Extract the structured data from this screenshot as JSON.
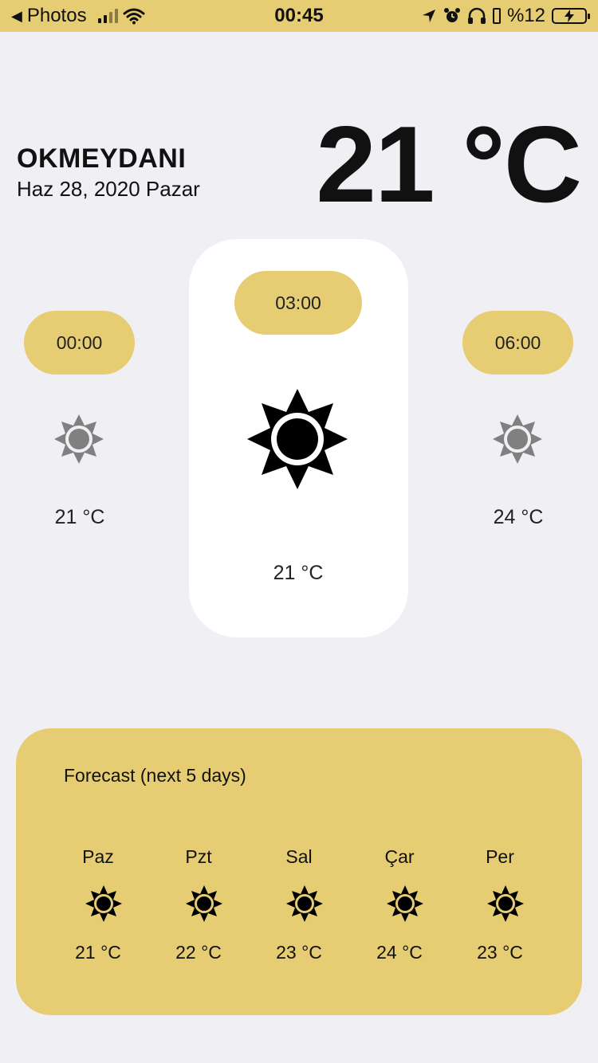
{
  "status_bar": {
    "back_app": "Photos",
    "time": "00:45",
    "battery": "%12",
    "icons": [
      "back-arrow-icon",
      "signal-icon",
      "wifi-icon",
      "location-arrow-icon",
      "alarm-icon",
      "headphones-icon",
      "battery-charging-icon"
    ]
  },
  "header": {
    "location": "OKMEYDANI",
    "date": "Haz 28, 2020 Pazar",
    "temperature": "21 °C"
  },
  "hourly": [
    {
      "time": "00:00",
      "temp": "21 °C",
      "icon": "sun-icon"
    },
    {
      "time": "03:00",
      "temp": "21 °C",
      "icon": "sun-icon",
      "selected": true
    },
    {
      "time": "06:00",
      "temp": "24 °C",
      "icon": "sun-icon"
    }
  ],
  "forecast": {
    "title": "Forecast (next 5 days)",
    "days": [
      {
        "day": "Paz",
        "temp": "21 °C",
        "icon": "sun-icon"
      },
      {
        "day": "Pzt",
        "temp": "22 °C",
        "icon": "sun-icon"
      },
      {
        "day": "Sal",
        "temp": "23 °C",
        "icon": "sun-icon"
      },
      {
        "day": "Çar",
        "temp": "24 °C",
        "icon": "sun-icon"
      },
      {
        "day": "Per",
        "temp": "23 °C",
        "icon": "sun-icon"
      }
    ]
  },
  "colors": {
    "accent": "#e6cc72",
    "background": "#efeff4",
    "card": "#ffffff",
    "icon_inactive": "#808080",
    "icon_active": "#000000"
  }
}
